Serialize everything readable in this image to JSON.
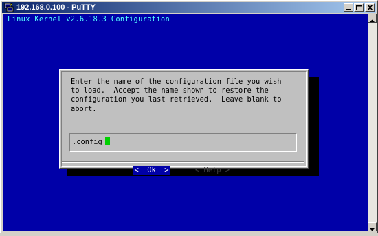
{
  "window": {
    "title": "192.168.0.100 - PuTTY",
    "buttons": [
      "minimize-icon",
      "maximize-icon",
      "close-icon"
    ]
  },
  "terminal": {
    "header": "Linux Kernel v2.6.18.3 Configuration",
    "background_color": "#0000a8",
    "header_color": "#55ffff"
  },
  "dialog": {
    "prompt": "Enter the name of the configuration file you wish\nto load.  Accept the name shown to restore the\nconfiguration you last retrieved.  Leave blank to\nabort.",
    "input_value": ".config",
    "ok_label": "<  Ok  >",
    "help_label": "< Help >"
  }
}
